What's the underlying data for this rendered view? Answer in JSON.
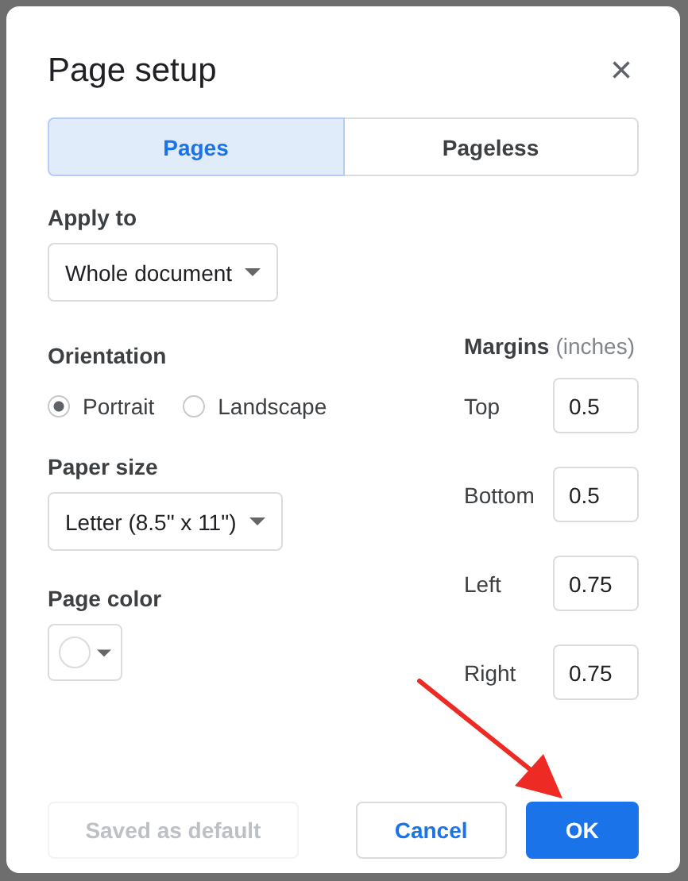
{
  "dialog": {
    "title": "Page setup",
    "close": "×"
  },
  "tabs": [
    {
      "label": "Pages",
      "selected": true
    },
    {
      "label": "Pageless",
      "selected": false
    }
  ],
  "apply_to": {
    "label": "Apply to",
    "value": "Whole document"
  },
  "orientation": {
    "label": "Orientation",
    "options": [
      {
        "label": "Portrait",
        "selected": true
      },
      {
        "label": "Landscape",
        "selected": false
      }
    ]
  },
  "paper_size": {
    "label": "Paper size",
    "value": "Letter (8.5\" x 11\")"
  },
  "page_color": {
    "label": "Page color",
    "color": "#ffffff"
  },
  "margins": {
    "label": "Margins",
    "unit": "(inches)",
    "fields": [
      {
        "label": "Top",
        "value": "0.5"
      },
      {
        "label": "Bottom",
        "value": "0.5"
      },
      {
        "label": "Left",
        "value": "0.75"
      },
      {
        "label": "Right",
        "value": "0.75"
      }
    ]
  },
  "buttons": [
    {
      "label": "Saved as default",
      "kind": "disabled"
    },
    {
      "label": "Cancel",
      "kind": "secondary"
    },
    {
      "label": "OK",
      "kind": "primary"
    }
  ],
  "annotation": {
    "arrow": true
  }
}
